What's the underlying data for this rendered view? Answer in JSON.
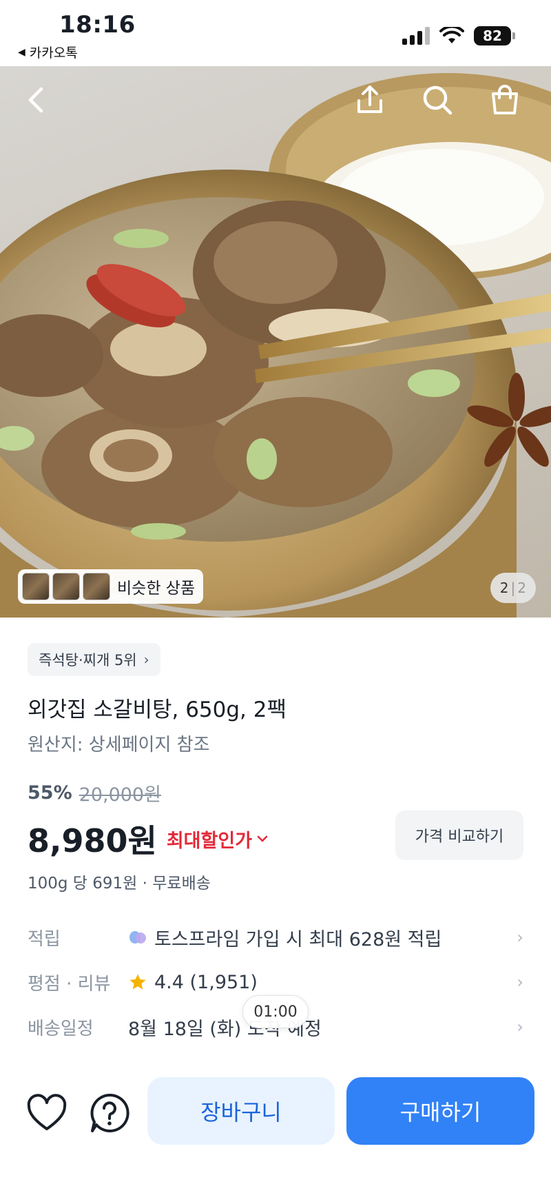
{
  "status_bar": {
    "time": "18:16",
    "back_app": "카카오톡",
    "battery": "82"
  },
  "hero": {
    "similar_label": "비슷한 상품",
    "page_current": "2",
    "page_separator": "|",
    "page_total": "2",
    "icons": [
      "back-icon",
      "share-icon",
      "search-icon",
      "shopping-bag-icon"
    ]
  },
  "product": {
    "rank_chip": "즉석탕·찌개 5위",
    "title": "외갓집 소갈비탕, 650g, 2팩",
    "origin": "원산지: 상세페이지 참조",
    "discount_rate": "55%",
    "original_price": "20,000원",
    "price": "8,980원",
    "best_price_label": "최대할인가",
    "compare_button": "가격 비교하기",
    "unit_price": "100g 당 691원 · 무료배송"
  },
  "info_rows": [
    {
      "label": "적립",
      "value": "토스프라임 가입 시 최대 628원 적립"
    },
    {
      "label": "평점 · 리뷰",
      "value": "4.4 (1,951)"
    },
    {
      "label": "배송일정",
      "value": "8월 18일 (화) 도착 예정"
    }
  ],
  "timer": "01:00",
  "bottom_bar": {
    "cart_button": "장바구니",
    "buy_button": "구매하기"
  },
  "colors": {
    "accent_blue": "#3182f6",
    "cart_bg": "#e8f3ff",
    "discount_red": "#e42939",
    "star": "#f5b301"
  }
}
